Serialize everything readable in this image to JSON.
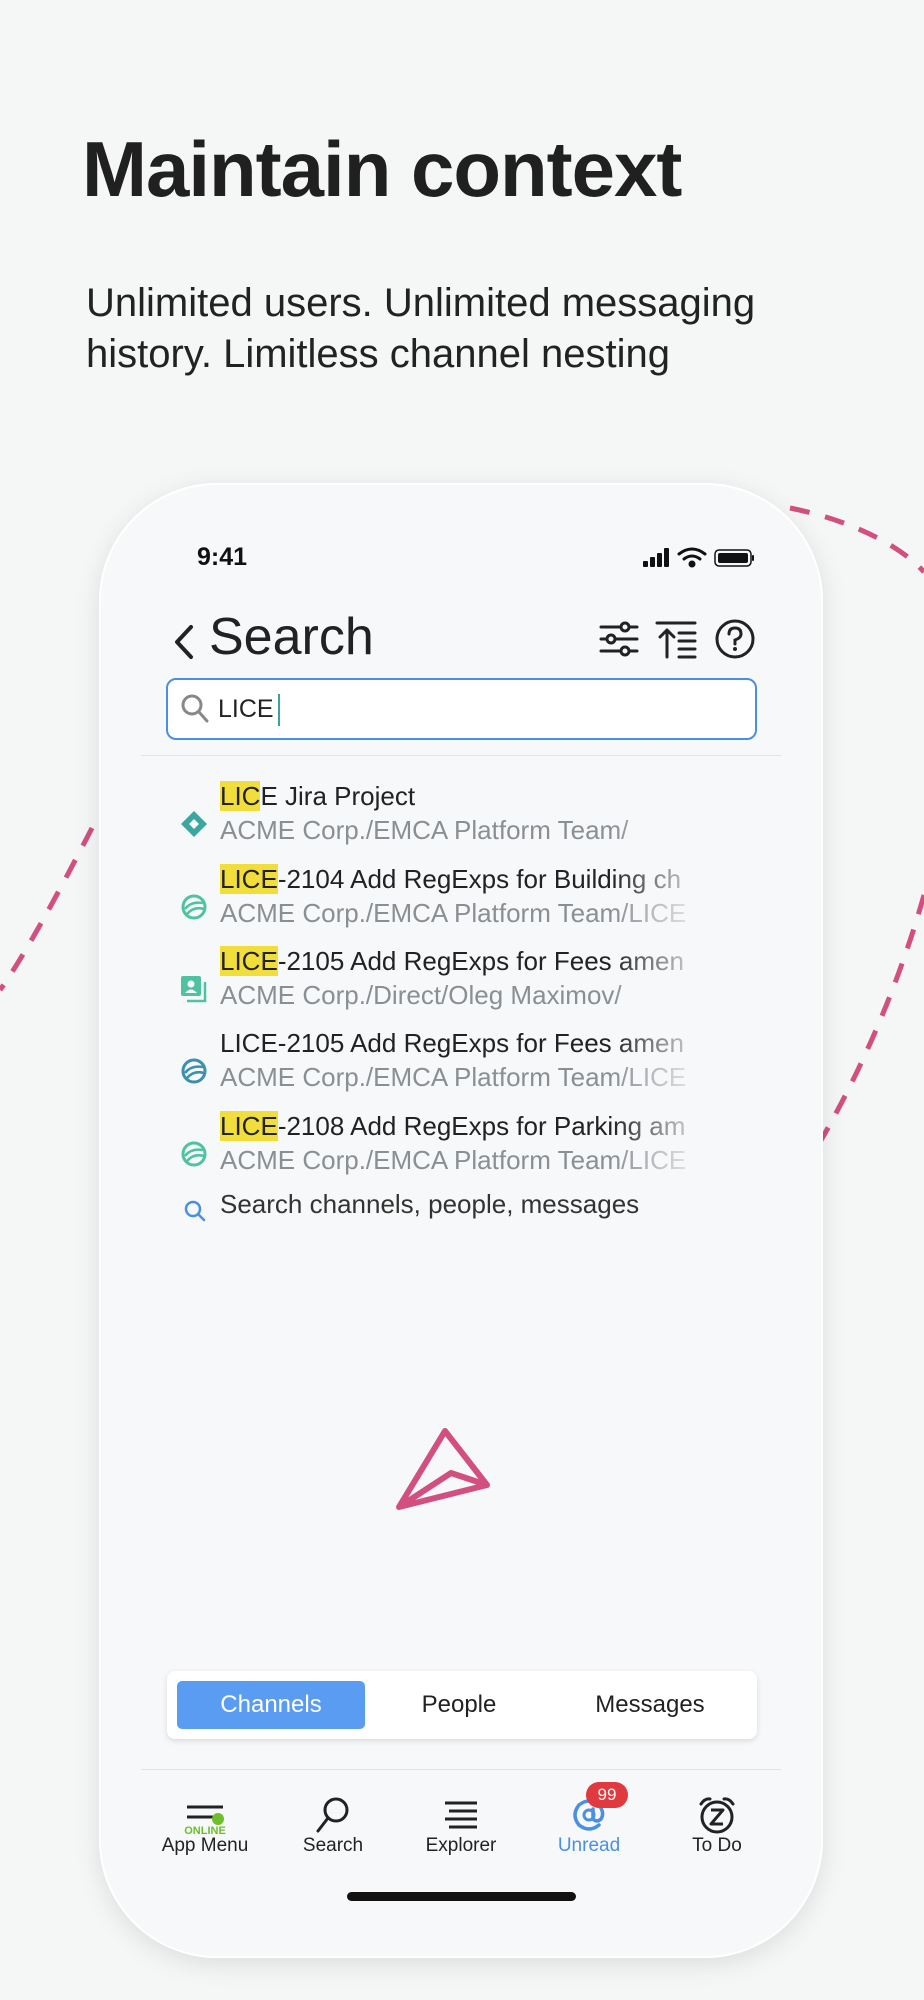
{
  "promo": {
    "headline": "Maintain context",
    "subline": "Unlimited users. Unlimited messaging history. Limitless channel nesting"
  },
  "status_bar": {
    "time": "9:41"
  },
  "header": {
    "title": "Search"
  },
  "search": {
    "value": "LICE"
  },
  "results": [
    {
      "icon": "jira-project-icon",
      "highlight": "LIC",
      "rest": "E Jira Project",
      "subtitle": "ACME Corp./EMCA Platform Team/"
    },
    {
      "icon": "issue-globe-icon",
      "highlight": "LICE",
      "rest": "-2104 Add RegExps for Building ch",
      "subtitle": "ACME Corp./EMCA Platform Team/LICE"
    },
    {
      "icon": "direct-contact-icon",
      "highlight": "LICE",
      "rest": "-2105 Add RegExps for Fees amen",
      "subtitle": "ACME Corp./Direct/Oleg Maximov/"
    },
    {
      "icon": "issue-globe-icon",
      "highlight": "",
      "rest": "LICE-2105 Add RegExps for Fees amen",
      "subtitle": "ACME Corp./EMCA Platform Team/LICE"
    },
    {
      "icon": "issue-globe-icon",
      "highlight": "LICE",
      "rest": "-2108 Add RegExps for Parking am",
      "subtitle": "ACME Corp./EMCA Platform Team/LICE"
    }
  ],
  "search_more": {
    "label": "Search channels, people, messages"
  },
  "segments": [
    {
      "label": "Channels",
      "active": true
    },
    {
      "label": "People",
      "active": false
    },
    {
      "label": "Messages",
      "active": false
    }
  ],
  "tabbar": {
    "app_menu": {
      "label": "App Menu",
      "status": "ONLINE"
    },
    "search": {
      "label": "Search"
    },
    "explorer": {
      "label": "Explorer"
    },
    "unread": {
      "label": "Unread",
      "badge": "99"
    },
    "todo": {
      "label": "To Do"
    }
  },
  "colors": {
    "accent": "#4a90e2",
    "segment_active": "#5b9cf3",
    "highlight": "#f2de3a",
    "deco_dash": "#d24f7f",
    "badge": "#e0393e",
    "online": "#6cbf2a"
  }
}
